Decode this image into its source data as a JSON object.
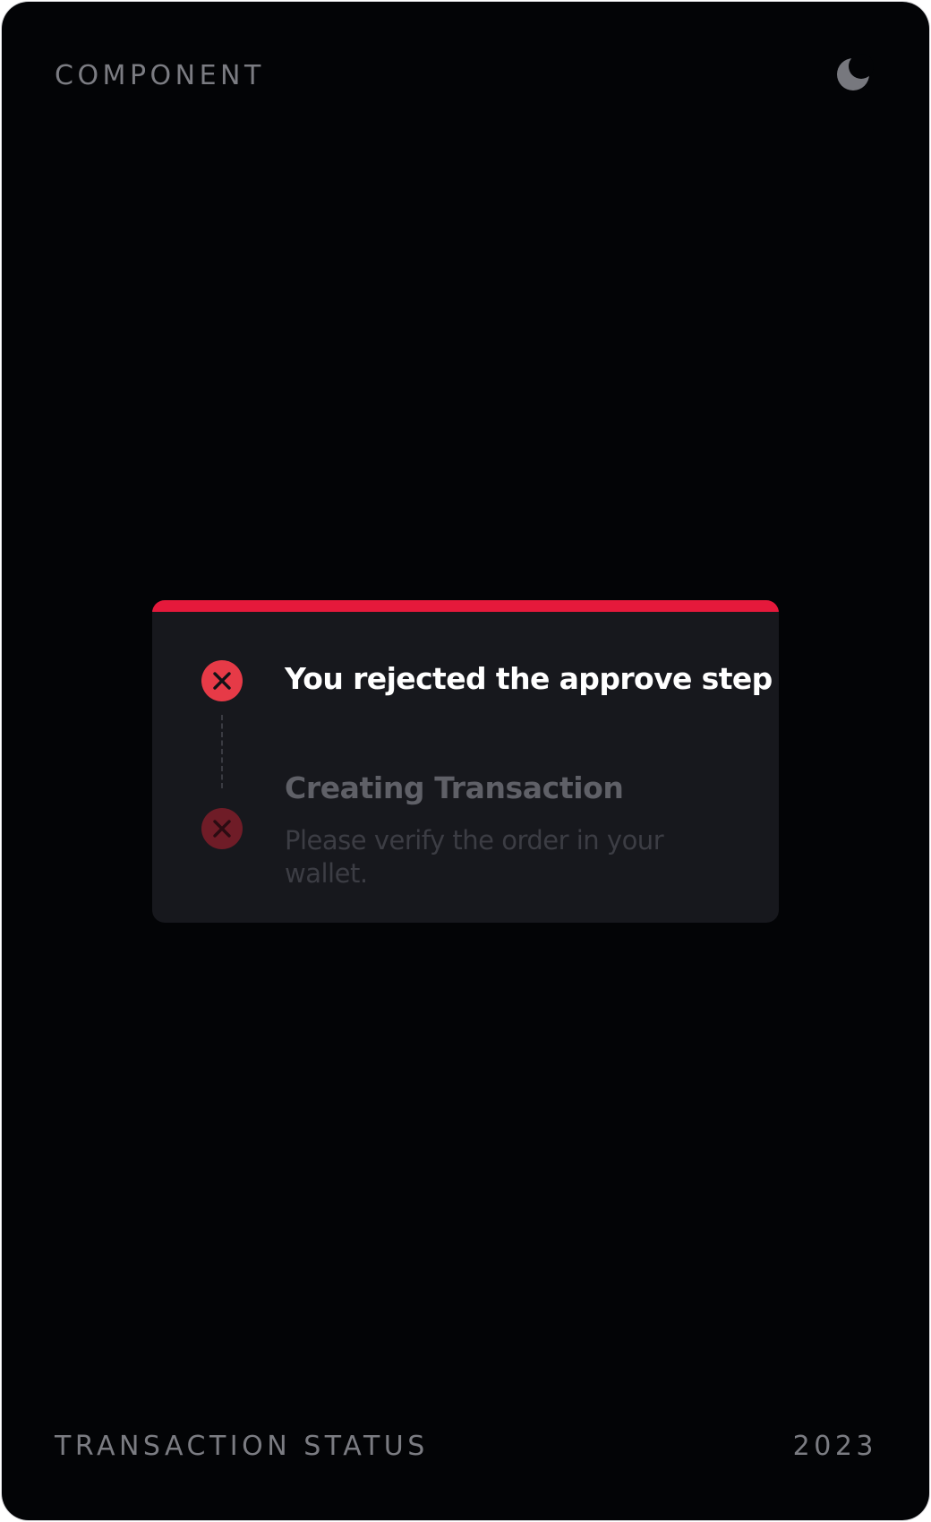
{
  "header": {
    "label": "COMPONENT",
    "theme_icon": "moon-icon"
  },
  "footer": {
    "title": "TRANSACTION STATUS",
    "year": "2023"
  },
  "status_card": {
    "accent_color": "#e5193b",
    "steps": [
      {
        "status": "rejected",
        "icon": "x-circle-icon",
        "title": "You rejected the approve step"
      },
      {
        "status": "rejected",
        "icon": "x-circle-icon",
        "title": "Creating Transaction",
        "description": "Please verify the order in your wallet."
      }
    ]
  }
}
